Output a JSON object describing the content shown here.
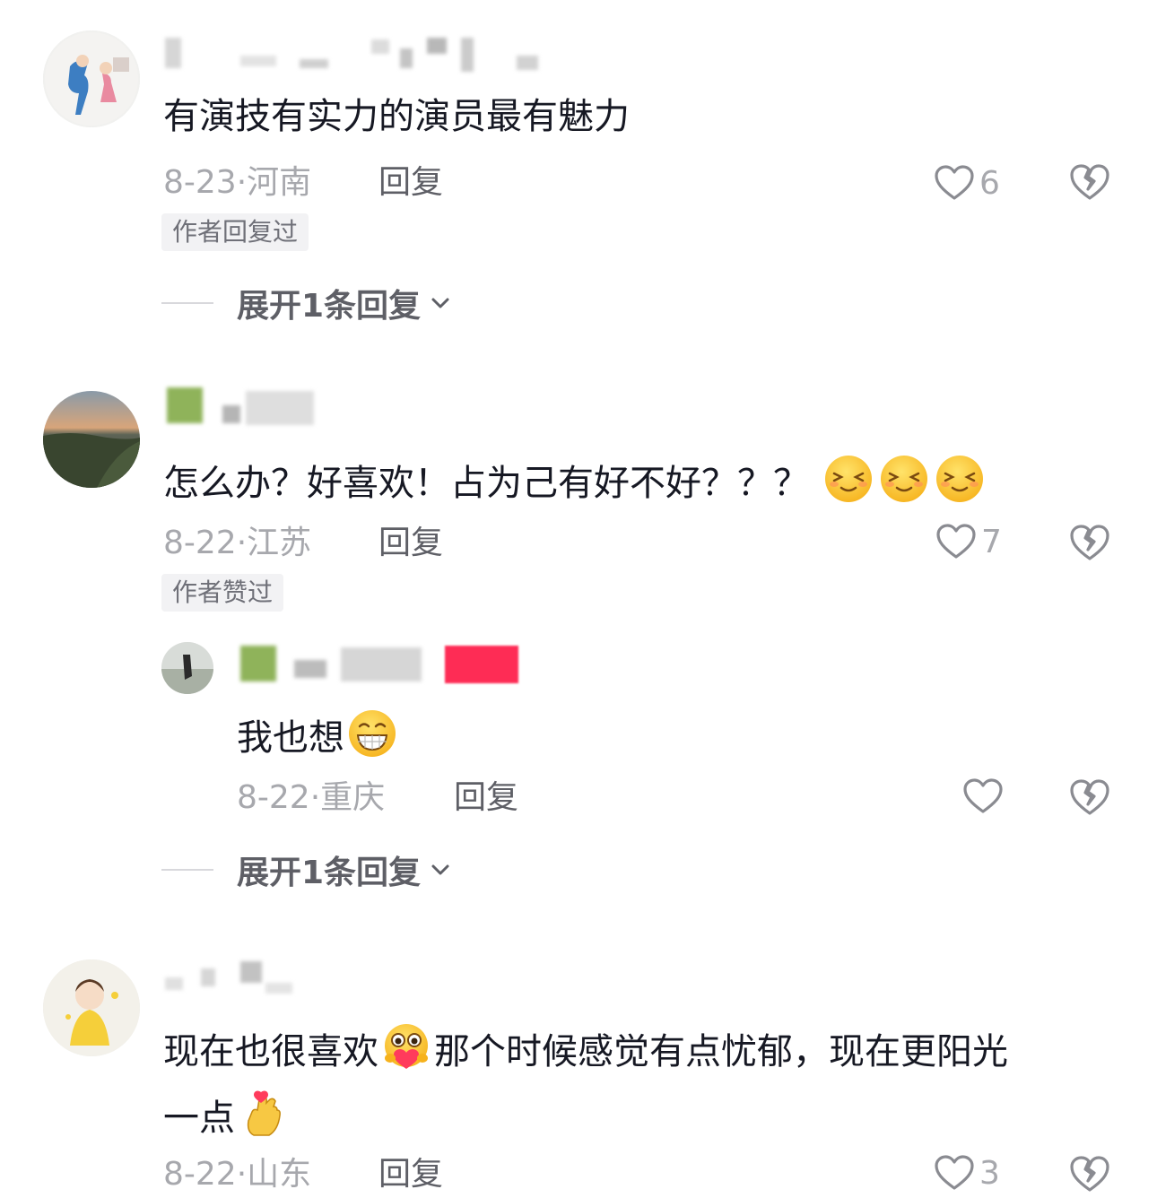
{
  "comments": [
    {
      "text": "有演技有实力的演员最有魅力",
      "date": "8-23·",
      "location": "河南",
      "reply_label": "回复",
      "likes": "6",
      "badge": "作者回复过",
      "expand_label": "展开1条回复"
    },
    {
      "text": "怎么办？好喜欢！占为己有好不好？？？",
      "emoji": "squinting-face-emoji",
      "date": "8-22·",
      "location": "江苏",
      "reply_label": "回复",
      "likes": "7",
      "badge": "作者赞过",
      "subreply": {
        "text": "我也想",
        "emoji": "grinning-face-emoji",
        "date": "8-22·",
        "location": "重庆",
        "reply_label": "回复",
        "likes": ""
      },
      "expand_label": "展开1条回复"
    },
    {
      "text_part1": "现在也很喜欢",
      "emoji1": "heart-hugging-face-emoji",
      "text_part2": "那个时候感觉有点忧郁，现在更阳光",
      "text_line2": "一点",
      "emoji2": "finger-heart-emoji",
      "date": "8-22·",
      "location": "山东",
      "reply_label": "回复",
      "likes": "3"
    }
  ],
  "colors": {
    "text": "#161823",
    "meta": "#a7a8ad",
    "secondary": "#5e5f66",
    "badge_bg": "#f2f2f4"
  }
}
